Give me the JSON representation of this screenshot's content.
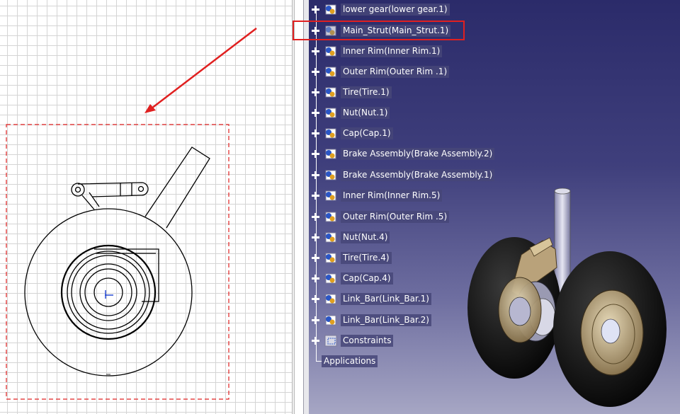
{
  "spec_tree": {
    "items": [
      {
        "label": "lower gear(lower gear.1)",
        "icon": "part-gear-icon"
      },
      {
        "label": "Main_Strut(Main_Strut.1)",
        "icon": "part-gear-icon"
      },
      {
        "label": "Inner Rim(Inner Rim.1)",
        "icon": "part-gear-icon"
      },
      {
        "label": "Outer Rim(Outer Rim .1)",
        "icon": "part-gear-icon"
      },
      {
        "label": "Tire(Tire.1)",
        "icon": "part-gear-icon"
      },
      {
        "label": "Nut(Nut.1)",
        "icon": "part-gear-icon"
      },
      {
        "label": "Cap(Cap.1)",
        "icon": "part-gear-icon"
      },
      {
        "label": "Brake Assembly(Brake Assembly.2)",
        "icon": "part-gear-icon"
      },
      {
        "label": "Brake Assembly(Brake Assembly.1)",
        "icon": "part-gear-icon"
      },
      {
        "label": "Inner Rim(Inner Rim.5)",
        "icon": "part-gear-icon"
      },
      {
        "label": "Outer Rim(Outer Rim .5)",
        "icon": "part-gear-icon"
      },
      {
        "label": "Nut(Nut.4)",
        "icon": "part-gear-icon"
      },
      {
        "label": "Tire(Tire.4)",
        "icon": "part-gear-icon"
      },
      {
        "label": "Cap(Cap.4)",
        "icon": "part-gear-icon"
      },
      {
        "label": "Link_Bar(Link_Bar.1)",
        "icon": "part-gear-icon"
      },
      {
        "label": "Link_Bar(Link_Bar.2)",
        "icon": "part-gear-icon"
      },
      {
        "label": "Constraints",
        "icon": "constraints-icon"
      }
    ],
    "applications_label": "Applications",
    "highlighted_item": "Main_Strut(Main_Strut.1)"
  },
  "colors": {
    "annotation_red": "#e02020",
    "viewport_top": "#2b2b6a",
    "viewport_bottom": "#a6a6c4",
    "tire": "#0d0d0d",
    "rim": "#c8b48a"
  }
}
